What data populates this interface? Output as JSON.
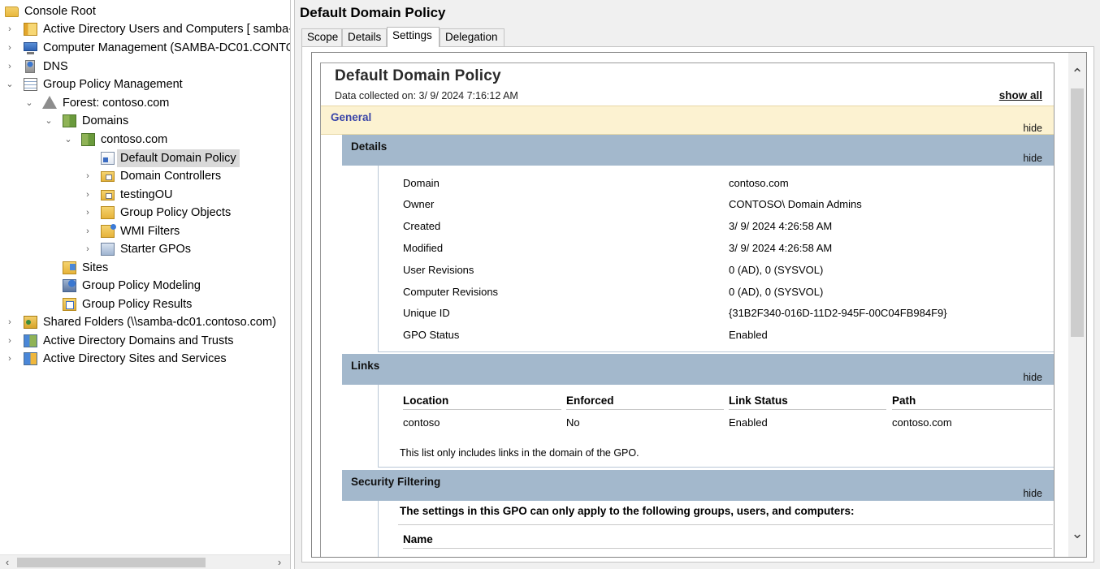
{
  "tree": {
    "items": [
      {
        "label": "Console Root",
        "icon": "folder-icon"
      },
      {
        "label": "Active Directory Users and Computers [ samba-",
        "icon": "ad-users-icon"
      },
      {
        "label": "Computer Management (SAMBA-DC01.CONTO",
        "icon": "computer-management-icon"
      },
      {
        "label": "DNS",
        "icon": "dns-icon"
      },
      {
        "label": "Group Policy Management",
        "icon": "group-policy-management-icon"
      },
      {
        "label": "Forest: contoso.com",
        "icon": "forest-icon"
      },
      {
        "label": "Domains",
        "icon": "domains-icon"
      },
      {
        "label": "contoso.com",
        "icon": "domain-icon"
      },
      {
        "label": "Default Domain Policy",
        "icon": "gpo-icon"
      },
      {
        "label": "Domain Controllers",
        "icon": "ou-icon"
      },
      {
        "label": "testingOU",
        "icon": "ou-icon"
      },
      {
        "label": "Group Policy Objects",
        "icon": "gpo-folder-icon"
      },
      {
        "label": "WMI Filters",
        "icon": "wmi-filter-icon"
      },
      {
        "label": "Starter GPOs",
        "icon": "starter-gpo-icon"
      },
      {
        "label": "Sites",
        "icon": "sites-icon"
      },
      {
        "label": "Group Policy Modeling",
        "icon": "gp-modeling-icon"
      },
      {
        "label": "Group Policy Results",
        "icon": "gp-results-icon"
      },
      {
        "label": "Shared Folders (\\\\samba-dc01.contoso.com)",
        "icon": "shared-folders-icon"
      },
      {
        "label": "Active Directory Domains and Trusts",
        "icon": "ad-trusts-icon"
      },
      {
        "label": "Active Directory Sites and Services",
        "icon": "ad-sites-icon"
      }
    ]
  },
  "pane": {
    "title": "Default Domain Policy",
    "tabs": [
      "Scope",
      "Details",
      "Settings",
      "Delegation"
    ],
    "active_tab": "Settings"
  },
  "report": {
    "title": "Default Domain Policy",
    "collected": "Data collected on: 3/ 9/ 2024 7:16:12 AM",
    "show_all": "show all",
    "hide": "hide",
    "general": "General",
    "details": {
      "heading": "Details",
      "rows": [
        {
          "key": "Domain",
          "value": "contoso.com"
        },
        {
          "key": "Owner",
          "value": "CONTOSO\\ Domain Admins"
        },
        {
          "key": "Created",
          "value": "3/ 9/ 2024 4:26:58 AM"
        },
        {
          "key": "Modified",
          "value": "3/ 9/ 2024 4:26:58 AM"
        },
        {
          "key": "User Revisions",
          "value": "0 (AD), 0 (SYSVOL)"
        },
        {
          "key": "Computer Revisions",
          "value": "0 (AD), 0 (SYSVOL)"
        },
        {
          "key": "Unique ID",
          "value": "{31B2F340-016D-11D2-945F-00C04FB984F9}"
        },
        {
          "key": "GPO Status",
          "value": "Enabled"
        }
      ]
    },
    "links": {
      "heading": "Links",
      "columns": [
        "Location",
        "Enforced",
        "Link Status",
        "Path"
      ],
      "rows": [
        [
          "contoso",
          "No",
          "Enabled",
          "contoso.com"
        ]
      ],
      "note": "This list only includes links in the domain of the GPO."
    },
    "security": {
      "heading": "Security Filtering",
      "intro": "The settings in this GPO can only apply to the following groups, users, and computers:",
      "columns": [
        "Name"
      ]
    }
  }
}
